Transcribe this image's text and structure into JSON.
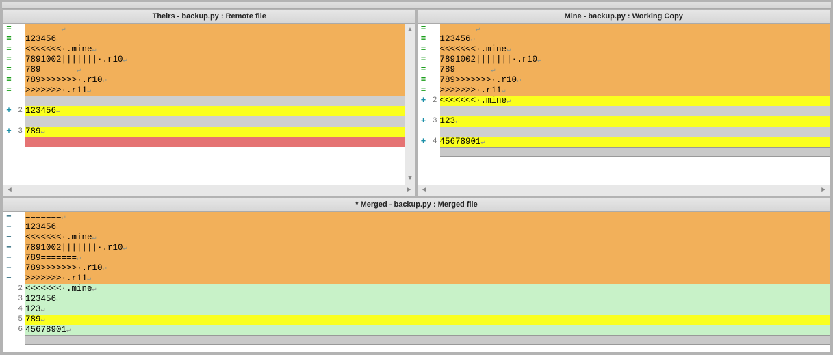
{
  "panes": {
    "theirs": {
      "title": "Theirs - backup.py : Remote file",
      "lines": [
        {
          "g": "=",
          "cls": "g-eq",
          "n": "",
          "bg": "bg-block",
          "t": "======="
        },
        {
          "g": "=",
          "cls": "g-eq",
          "n": "",
          "bg": "bg-block",
          "t": "123456"
        },
        {
          "g": "=",
          "cls": "g-eq",
          "n": "",
          "bg": "bg-block",
          "t": "<<<<<<<·.mine"
        },
        {
          "g": "=",
          "cls": "g-eq",
          "n": "",
          "bg": "bg-block",
          "t": "7891002|||||||·.r10"
        },
        {
          "g": "=",
          "cls": "g-eq",
          "n": "",
          "bg": "bg-block",
          "t": "789======="
        },
        {
          "g": "=",
          "cls": "g-eq",
          "n": "",
          "bg": "bg-block",
          "t": "789>>>>>>>·.r10"
        },
        {
          "g": "=",
          "cls": "g-eq",
          "n": "",
          "bg": "bg-block",
          "t": ">>>>>>>·.r11"
        },
        {
          "g": "",
          "cls": "",
          "n": "",
          "bg": "bg-grey",
          "t": "",
          "nosym": true
        },
        {
          "g": "+",
          "cls": "g-add",
          "n": "2",
          "bg": "bg-yellow",
          "t": "123456"
        },
        {
          "g": "",
          "cls": "",
          "n": "",
          "bg": "bg-grey",
          "t": "",
          "nosym": true
        },
        {
          "g": "+",
          "cls": "g-add",
          "n": "3",
          "bg": "bg-yellow",
          "t": "789"
        },
        {
          "g": "",
          "cls": "",
          "n": "",
          "bg": "bg-red",
          "t": "",
          "nosym": true
        },
        {
          "g": "",
          "cls": "",
          "n": "",
          "bg": "bg-white",
          "t": "",
          "nosym": true
        }
      ]
    },
    "mine": {
      "title": "Mine - backup.py : Working Copy",
      "lines": [
        {
          "g": "=",
          "cls": "g-eq",
          "n": "",
          "bg": "bg-block",
          "t": "======="
        },
        {
          "g": "=",
          "cls": "g-eq",
          "n": "",
          "bg": "bg-block",
          "t": "123456"
        },
        {
          "g": "=",
          "cls": "g-eq",
          "n": "",
          "bg": "bg-block",
          "t": "<<<<<<<·.mine"
        },
        {
          "g": "=",
          "cls": "g-eq",
          "n": "",
          "bg": "bg-block",
          "t": "7891002|||||||·.r10"
        },
        {
          "g": "=",
          "cls": "g-eq",
          "n": "",
          "bg": "bg-block",
          "t": "789======="
        },
        {
          "g": "=",
          "cls": "g-eq",
          "n": "",
          "bg": "bg-block",
          "t": "789>>>>>>>·.r10"
        },
        {
          "g": "=",
          "cls": "g-eq",
          "n": "",
          "bg": "bg-block",
          "t": ">>>>>>>·.r11"
        },
        {
          "g": "+",
          "cls": "g-add",
          "n": "2",
          "bg": "bg-yellow",
          "t": "<<<<<<<·.mine"
        },
        {
          "g": "",
          "cls": "",
          "n": "",
          "bg": "bg-grey",
          "t": "",
          "nosym": true
        },
        {
          "g": "+",
          "cls": "g-add",
          "n": "3",
          "bg": "bg-yellow",
          "t": "123"
        },
        {
          "g": "",
          "cls": "",
          "n": "",
          "bg": "bg-grey",
          "t": "",
          "nosym": true
        },
        {
          "g": "+",
          "cls": "g-add",
          "n": "4",
          "bg": "bg-yellow",
          "t": "45678901"
        },
        {
          "g": "",
          "cls": "",
          "n": "",
          "bg": "bg-grey",
          "t": "",
          "nosym": true,
          "sep": true
        }
      ]
    },
    "merged": {
      "title": "* Merged - backup.py : Merged file",
      "lines": [
        {
          "g": "−",
          "cls": "g-min",
          "n": "",
          "bg": "bg-block",
          "t": "======="
        },
        {
          "g": "−",
          "cls": "g-min",
          "n": "",
          "bg": "bg-block",
          "t": "123456"
        },
        {
          "g": "−",
          "cls": "g-min",
          "n": "",
          "bg": "bg-block",
          "t": "<<<<<<<·.mine"
        },
        {
          "g": "−",
          "cls": "g-min",
          "n": "",
          "bg": "bg-block",
          "t": "7891002|||||||·.r10"
        },
        {
          "g": "−",
          "cls": "g-min",
          "n": "",
          "bg": "bg-block",
          "t": "789======="
        },
        {
          "g": "−",
          "cls": "g-min",
          "n": "",
          "bg": "bg-block",
          "t": "789>>>>>>>·.r10"
        },
        {
          "g": "−",
          "cls": "g-min",
          "n": "",
          "bg": "bg-block",
          "t": ">>>>>>>·.r11"
        },
        {
          "g": "",
          "cls": "",
          "n": "2",
          "bg": "bg-green",
          "t": "<<<<<<<·.mine"
        },
        {
          "g": "",
          "cls": "",
          "n": "3",
          "bg": "bg-green",
          "t": "123456"
        },
        {
          "g": "",
          "cls": "",
          "n": "4",
          "bg": "bg-green",
          "t": "123"
        },
        {
          "g": "",
          "cls": "",
          "n": "5",
          "bg": "bg-yellow",
          "t": "789"
        },
        {
          "g": "",
          "cls": "",
          "n": "6",
          "bg": "bg-green",
          "t": "45678901"
        },
        {
          "g": "",
          "cls": "",
          "n": "",
          "bg": "bg-grey",
          "t": "",
          "nosym": true,
          "sep": true
        }
      ]
    }
  },
  "newline_symbol": "↵"
}
